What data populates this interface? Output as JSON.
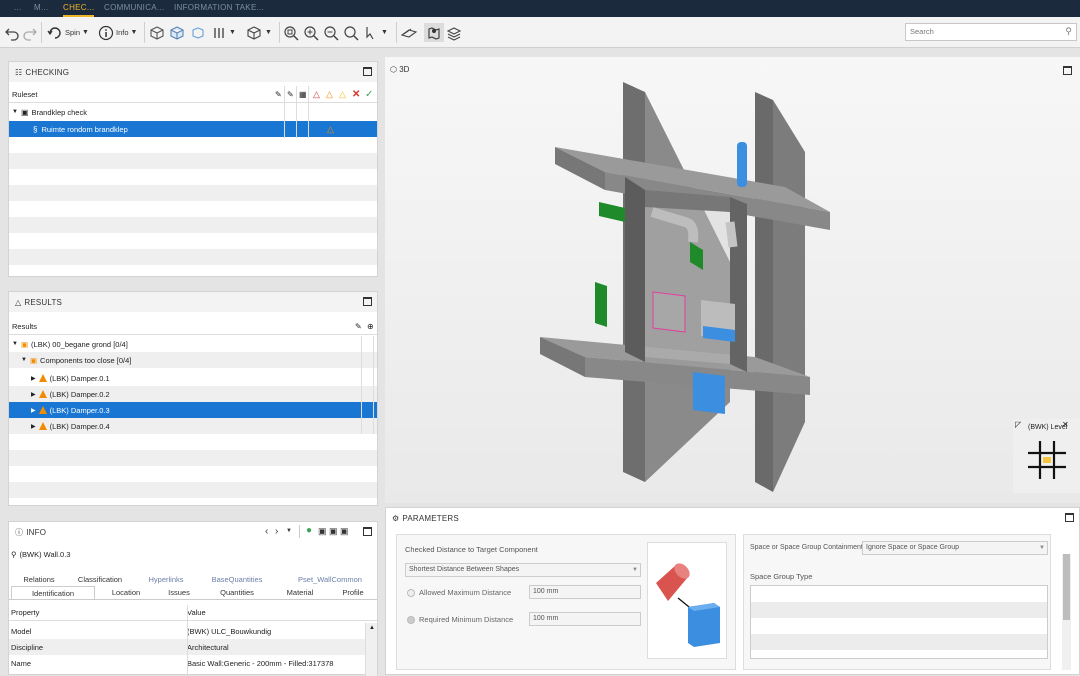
{
  "top_tabs": [
    "...",
    "M...",
    "CHEC...",
    "COMMUNICA...",
    "INFORMATION TAKE..."
  ],
  "toolbar": {
    "spin_label": "Spin",
    "info_label": "Info",
    "search_placeholder": "Search"
  },
  "checking": {
    "title": "CHECKING",
    "col_ruleset": "Ruleset",
    "tree": [
      {
        "label": "Brandklep check"
      },
      {
        "label": "Ruimte rondom brandklep"
      }
    ]
  },
  "results": {
    "title": "RESULTS",
    "col_results": "Results",
    "rows": [
      {
        "label": "(LBK) 00_begane grond [0/4]"
      },
      {
        "label": "Components too close [0/4]"
      },
      {
        "label": "(LBK) Damper.0.1"
      },
      {
        "label": "(LBK) Damper.0.2"
      },
      {
        "label": "(LBK) Damper.0.3"
      },
      {
        "label": "(LBK) Damper.0.4"
      }
    ]
  },
  "info": {
    "title": "INFO",
    "object": "(BWK) Wall.0.3",
    "tabs_row1": [
      "Relations",
      "Classification",
      "Hyperlinks",
      "BaseQuantities",
      "Pset_WallCommon"
    ],
    "tabs_row2": [
      "Identification",
      "Location",
      "Issues",
      "Quantities",
      "Material",
      "Profile"
    ],
    "col_property": "Property",
    "col_value": "Value",
    "props": [
      {
        "k": "Model",
        "v": "(BWK) ULC_Bouwkundig"
      },
      {
        "k": "Discipline",
        "v": "Architectural"
      },
      {
        "k": "Name",
        "v": "Basic Wall:Generic - 200mm - Filled:317378"
      }
    ]
  },
  "view3d": {
    "title": "3D",
    "level_label": "(BWK) Level"
  },
  "parameters": {
    "title": "PARAMETERS",
    "checked_distance_label": "Checked Distance to Target Component",
    "distance_mode": "Shortest Distance Between Shapes",
    "allowed_max_label": "Allowed Maximum Distance",
    "allowed_max_value": "100 mm",
    "required_min_label": "Required Minimum Distance",
    "required_min_value": "100 mm",
    "containment_label": "Space or Space Group Containment",
    "containment_value": "Ignore Space or Space Group",
    "space_group_type_label": "Space Group Type"
  },
  "colors": {
    "topbar": "#1b2b3d",
    "accent": "#f0b429",
    "selection": "#1976d2",
    "warning": "#f28c00"
  }
}
